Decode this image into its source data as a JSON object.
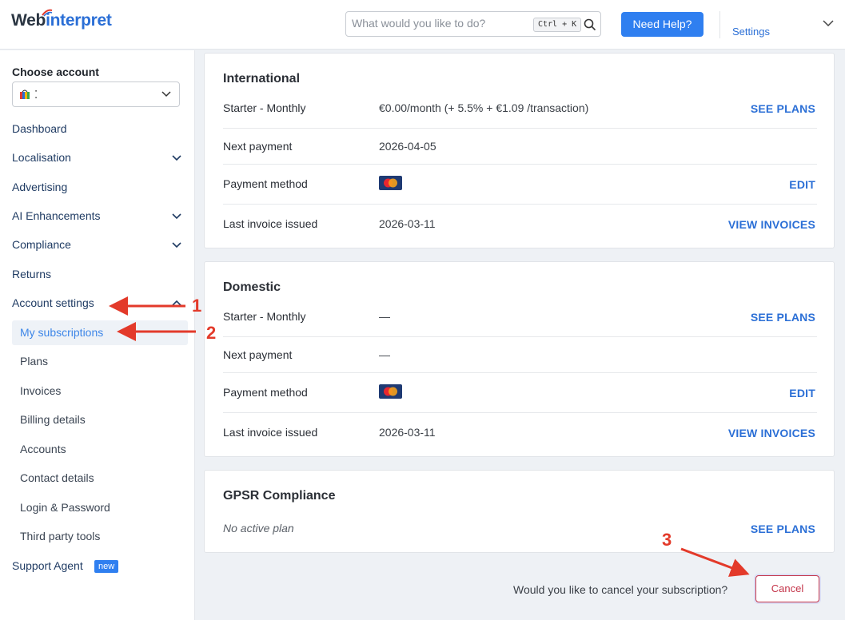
{
  "header": {
    "logo_part1": "Web",
    "logo_part2": "interpret",
    "search_placeholder": "What would you like to do?",
    "search_shortcut": "Ctrl + K",
    "help_label": "Need Help?",
    "settings_label": "Settings"
  },
  "sidebar": {
    "choose_label": "Choose account",
    "account_value": "⁚",
    "items": [
      {
        "label": "Dashboard"
      },
      {
        "label": "Localisation"
      },
      {
        "label": "Advertising"
      },
      {
        "label": "AI Enhancements"
      },
      {
        "label": "Compliance"
      },
      {
        "label": "Returns"
      },
      {
        "label": "Account settings"
      }
    ],
    "subitems": [
      {
        "label": "My subscriptions"
      },
      {
        "label": "Plans"
      },
      {
        "label": "Invoices"
      },
      {
        "label": "Billing details"
      },
      {
        "label": "Accounts"
      },
      {
        "label": "Contact details"
      },
      {
        "label": "Login & Password"
      },
      {
        "label": "Third party tools"
      }
    ],
    "support_label": "Support Agent",
    "new_badge": "new"
  },
  "cards": {
    "international": {
      "title": "International",
      "plan_label": "Starter - Monthly",
      "plan_value": "€0.00/month (+ 5.5% + €1.09 /transaction)",
      "plan_action": "SEE PLANS",
      "next_label": "Next payment",
      "next_value": "2026-04-05",
      "method_label": "Payment method",
      "method_action": "EDIT",
      "invoice_label": "Last invoice issued",
      "invoice_value": "2026-03-11",
      "invoice_action": "VIEW INVOICES"
    },
    "domestic": {
      "title": "Domestic",
      "plan_label": "Starter - Monthly",
      "plan_value": "—",
      "plan_action": "SEE PLANS",
      "next_label": "Next payment",
      "next_value": "—",
      "method_label": "Payment method",
      "method_action": "EDIT",
      "invoice_label": "Last invoice issued",
      "invoice_value": "2026-03-11",
      "invoice_action": "VIEW INVOICES"
    },
    "gpsr": {
      "title": "GPSR Compliance",
      "status": "No active plan",
      "action": "SEE PLANS"
    }
  },
  "cancel": {
    "question": "Would you like to cancel your subscription?",
    "button": "Cancel"
  },
  "annotations": [
    "1",
    "2",
    "3"
  ],
  "colors": {
    "accent": "#2f7ff0",
    "link": "#2b6fd6",
    "danger": "#c4354a",
    "annotation": "#e33a2a"
  }
}
